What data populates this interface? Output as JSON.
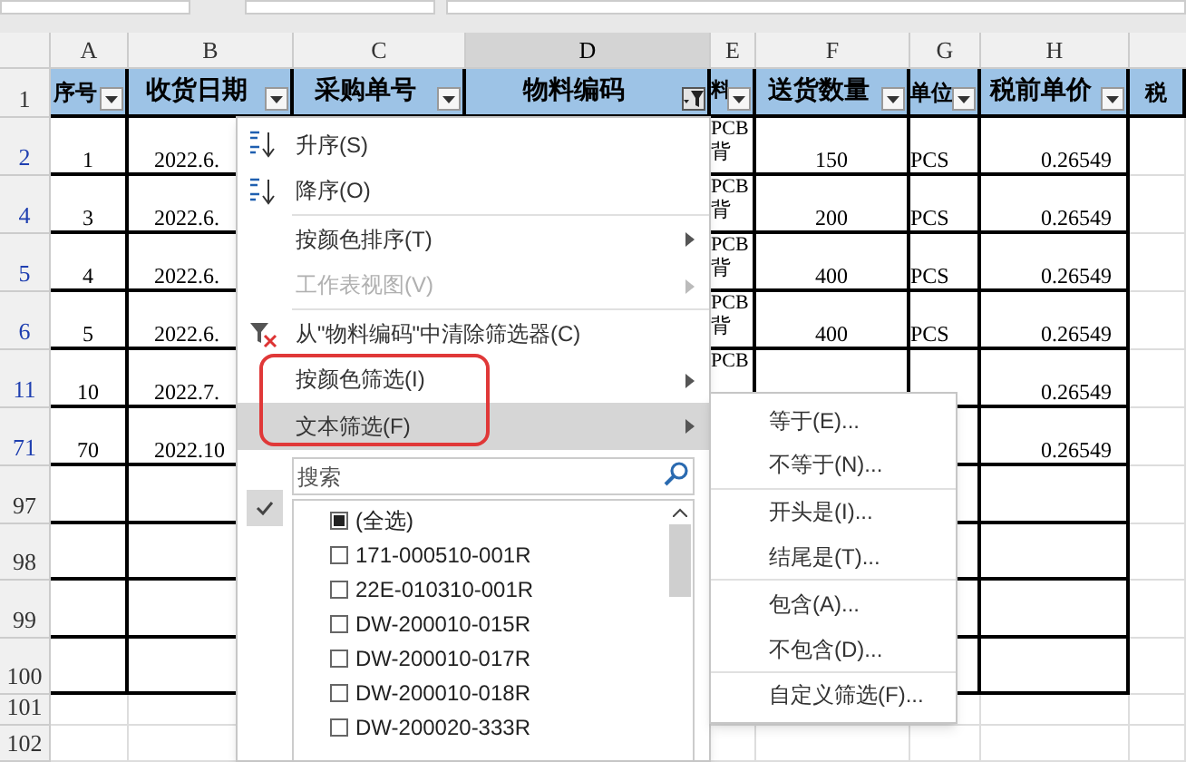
{
  "columns": [
    {
      "letter": "A",
      "selected": false
    },
    {
      "letter": "B",
      "selected": false
    },
    {
      "letter": "C",
      "selected": false
    },
    {
      "letter": "D",
      "selected": true
    },
    {
      "letter": "E",
      "selected": false
    },
    {
      "letter": "F",
      "selected": false
    },
    {
      "letter": "G",
      "selected": false
    },
    {
      "letter": "H",
      "selected": false
    }
  ],
  "header_row": {
    "row_number": "1",
    "cells": [
      {
        "text": "序号",
        "filter_active": false
      },
      {
        "text": "收货日期",
        "filter_active": false
      },
      {
        "text": "采购单号",
        "filter_active": false
      },
      {
        "text": "物料编码",
        "filter_active": true
      },
      {
        "text": "料",
        "filter_active": false
      },
      {
        "text": "送货数量",
        "filter_active": false
      },
      {
        "text": "单位",
        "filter_active": false
      },
      {
        "text": "税前单价",
        "filter_active": false
      },
      {
        "text": "税"
      }
    ]
  },
  "rows": [
    {
      "row_number": "2",
      "filtered": true,
      "cells": {
        "A": "1",
        "B": "2022.6.",
        "E": "PCB背",
        "F": "150",
        "G": "PCS",
        "H": "0.26549"
      }
    },
    {
      "row_number": "4",
      "filtered": true,
      "cells": {
        "A": "3",
        "B": "2022.6.",
        "E": "PCB背",
        "F": "200",
        "G": "PCS",
        "H": "0.26549"
      }
    },
    {
      "row_number": "5",
      "filtered": true,
      "cells": {
        "A": "4",
        "B": "2022.6.",
        "E": "PCB背",
        "F": "400",
        "G": "PCS",
        "H": "0.26549"
      }
    },
    {
      "row_number": "6",
      "filtered": true,
      "cells": {
        "A": "5",
        "B": "2022.6.",
        "E": "PCB背",
        "F": "400",
        "G": "PCS",
        "H": "0.26549"
      }
    },
    {
      "row_number": "11",
      "filtered": true,
      "cells": {
        "A": "10",
        "B": "2022.7.",
        "E": "PCB",
        "H": "0.26549"
      }
    },
    {
      "row_number": "71",
      "filtered": true,
      "cells": {
        "A": "70",
        "B": "2022.10",
        "H": "0.26549"
      }
    },
    {
      "row_number": "97",
      "filtered": false,
      "cells": {}
    },
    {
      "row_number": "98",
      "filtered": false,
      "cells": {}
    },
    {
      "row_number": "99",
      "filtered": false,
      "cells": {}
    },
    {
      "row_number": "100",
      "filtered": false,
      "cells": {}
    },
    {
      "row_number": "101",
      "filtered": false,
      "cells": {}
    },
    {
      "row_number": "102",
      "filtered": false,
      "cells": {}
    }
  ],
  "filter_menu": {
    "items": [
      {
        "label": "升序(S)",
        "disabled": false,
        "submenu": false,
        "highlighted": false
      },
      {
        "label": "降序(O)",
        "disabled": false,
        "submenu": false,
        "highlighted": false
      },
      {
        "label": "按颜色排序(T)",
        "disabled": false,
        "submenu": true,
        "highlighted": false
      },
      {
        "label": "工作表视图(V)",
        "disabled": true,
        "submenu": true,
        "highlighted": false
      },
      {
        "label": "从\"物料编码\"中清除筛选器(C)",
        "disabled": false,
        "submenu": false,
        "highlighted": false
      },
      {
        "label": "按颜色筛选(I)",
        "disabled": false,
        "submenu": true,
        "highlighted": false
      },
      {
        "label": "文本筛选(F)",
        "disabled": false,
        "submenu": true,
        "highlighted": true
      }
    ],
    "search": {
      "placeholder": "搜索"
    },
    "values": [
      {
        "label": "(全选)",
        "checked": false,
        "indeterminate": true
      },
      {
        "label": "171-000510-001R",
        "checked": false,
        "indeterminate": false
      },
      {
        "label": "22E-010310-001R",
        "checked": false,
        "indeterminate": false
      },
      {
        "label": "DW-200010-015R",
        "checked": false,
        "indeterminate": false
      },
      {
        "label": "DW-200010-017R",
        "checked": false,
        "indeterminate": false
      },
      {
        "label": "DW-200010-018R",
        "checked": false,
        "indeterminate": false
      },
      {
        "label": "DW-200020-333R",
        "checked": false,
        "indeterminate": false
      }
    ]
  },
  "text_filter_submenu": {
    "items": [
      {
        "label": "等于(E)...",
        "separator_after": false
      },
      {
        "label": "不等于(N)...",
        "separator_after": true
      },
      {
        "label": "开头是(I)...",
        "separator_after": false
      },
      {
        "label": "结尾是(T)...",
        "separator_after": true
      },
      {
        "label": "包含(A)...",
        "separator_after": false
      },
      {
        "label": "不包含(D)...",
        "separator_after": true
      },
      {
        "label": "自定义筛选(F)...",
        "separator_after": false
      }
    ]
  }
}
